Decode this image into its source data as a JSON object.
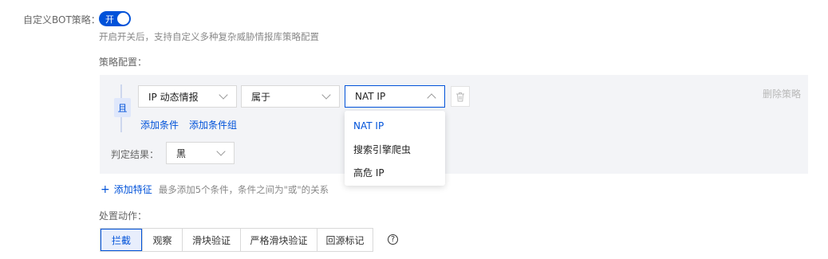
{
  "bot_policy": {
    "label": "自定义BOT策略：",
    "toggle_label": "开",
    "hint": "开启开关后，支持自定义多种复杂威胁情报库策略配置"
  },
  "strategy": {
    "label": "策略配置：",
    "and_badge": "且",
    "field_select": "IP 动态情报",
    "operator_select": "属于",
    "value_select": "NAT IP",
    "add_condition": "添加条件",
    "add_condition_group": "添加条件组",
    "delete_strategy": "删除策略",
    "result_label": "判定结果：",
    "result_select": "黑",
    "dropdown_options": [
      "NAT IP",
      "搜索引擎爬虫",
      "高危 IP"
    ]
  },
  "add_feature": {
    "plus": "+",
    "label": "添加特征",
    "hint": "最多添加5个条件，条件之间为\"或\"的关系"
  },
  "action": {
    "label": "处置动作：",
    "buttons": [
      "拦截",
      "观察",
      "滑块验证",
      "严格滑块验证",
      "回源标记"
    ],
    "help": "?"
  },
  "colors": {
    "accent": "#0052d9",
    "panel_bg": "#f3f4f7"
  },
  "icons": [
    "chevron-down-icon",
    "chevron-up-icon",
    "trash-icon",
    "question-circle-icon",
    "plus-icon"
  ]
}
